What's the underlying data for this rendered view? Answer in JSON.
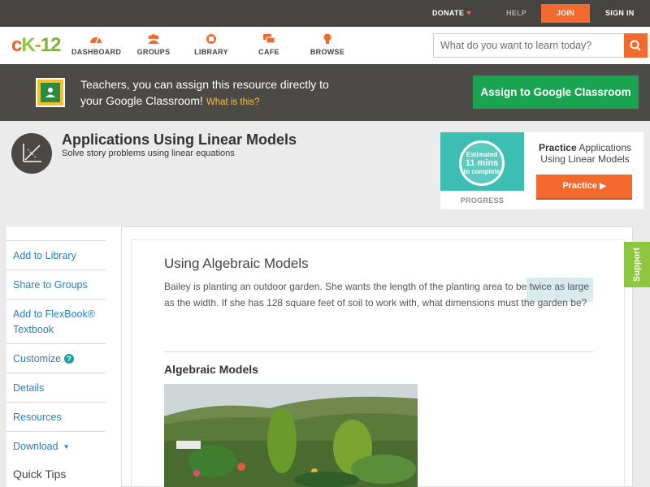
{
  "topbar": {
    "donate": "DONATE",
    "help": "HELP",
    "join": "JOIN",
    "signin": "SIGN IN"
  },
  "logo": {
    "c": "c",
    "k": "K",
    "dash": "-",
    "num": "12"
  },
  "nav": {
    "dashboard": "DASHBOARD",
    "groups": "GROUPS",
    "library": "LIBRARY",
    "cafe": "CAFE",
    "browse": "BROWSE"
  },
  "search": {
    "placeholder": "What do you want to learn today?"
  },
  "teacher": {
    "line1": "Teachers, you can assign this resource directly to",
    "line2": "your Google Classroom!",
    "what": "What is this?",
    "assign": "Assign to Google Classroom"
  },
  "page": {
    "title": "Applications Using Linear Models",
    "subtitle": "Solve story problems using linear equations"
  },
  "practice": {
    "estimated": "Estimated",
    "mins": "11 mins",
    "complete": "to complete",
    "progress_label": "PROGRESS",
    "title_bold": "Practice",
    "title_rest": "Applications Using Linear Models",
    "button": "Practice"
  },
  "sidebar": {
    "add_library": "Add to Library",
    "share_groups": "Share to Groups",
    "add_flexbook_1": "Add to FlexBook®",
    "add_flexbook_2": "Textbook",
    "customize": "Customize",
    "details": "Details",
    "resources": "Resources",
    "download": "Download",
    "quick_tips": "Quick Tips"
  },
  "main": {
    "heading": "Using Algebraic Models",
    "paragraph": "Bailey is planting an outdoor garden. She wants the length of the planting area to be twice as large as the width. If she has 128 square feet of soil to work with, what dimensions must the garden be?",
    "subheading": "Algebraic Models"
  },
  "support": "Support",
  "colors": {
    "accent": "#f26a2e",
    "green": "#1aa351",
    "link": "#2a7fb8",
    "support": "#8dc63f"
  }
}
